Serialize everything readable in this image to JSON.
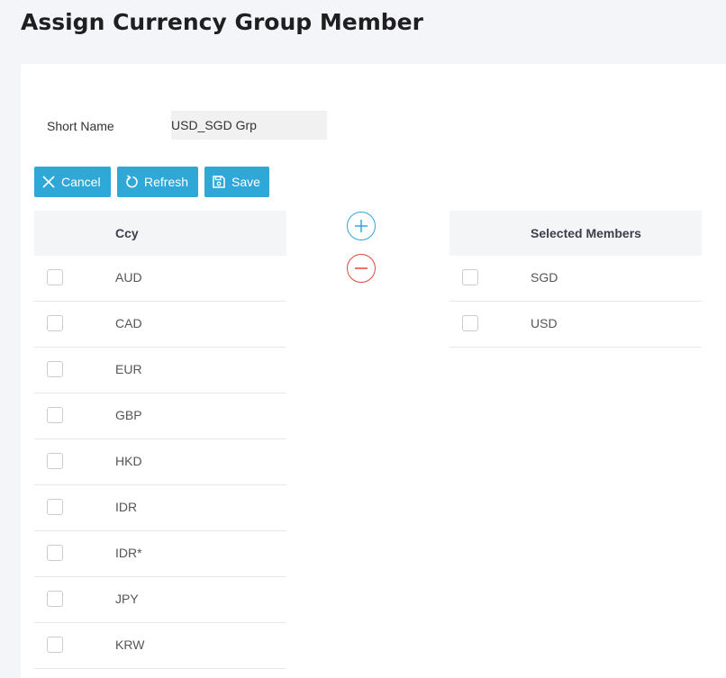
{
  "page": {
    "title": "Assign Currency Group Member"
  },
  "form": {
    "short_name_label": "Short Name",
    "short_name_value": "USD_SGD Grp"
  },
  "toolbar": {
    "cancel_label": "Cancel",
    "refresh_label": "Refresh",
    "save_label": "Save"
  },
  "available": {
    "header": "Ccy",
    "rows": [
      "AUD",
      "CAD",
      "EUR",
      "GBP",
      "HKD",
      "IDR",
      "IDR*",
      "JPY",
      "KRW"
    ]
  },
  "selected": {
    "header": "Selected Members",
    "rows": [
      "SGD",
      "USD"
    ]
  },
  "colors": {
    "primary": "#2fa8d8",
    "danger": "#e0463c",
    "header_bg": "#f4f5f7",
    "page_bg": "#f3f5f8"
  },
  "icons": {
    "cancel": "close-icon",
    "refresh": "refresh-icon",
    "save": "save-icon",
    "add": "plus-circle-icon",
    "remove": "minus-circle-icon"
  }
}
